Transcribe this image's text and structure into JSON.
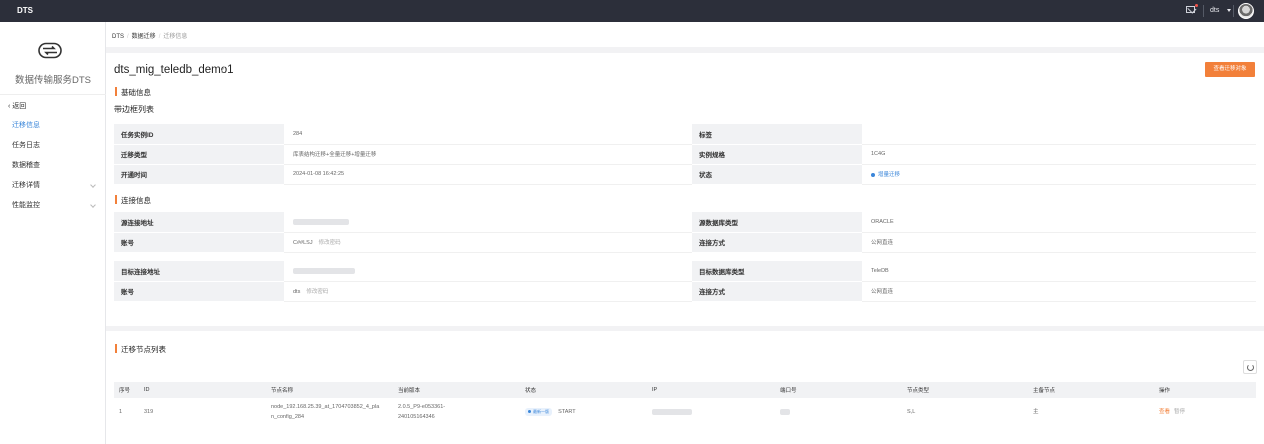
{
  "app": {
    "brand": "DTS",
    "user": "dts"
  },
  "sidebar": {
    "service_name": "数据传输服务DTS",
    "back_label": "返回",
    "items": [
      {
        "label": "迁移信息",
        "active": true,
        "expandable": false
      },
      {
        "label": "任务日志",
        "active": false,
        "expandable": false
      },
      {
        "label": "数据稽查",
        "active": false,
        "expandable": false
      },
      {
        "label": "迁移详情",
        "active": false,
        "expandable": true
      },
      {
        "label": "性能监控",
        "active": false,
        "expandable": true
      }
    ]
  },
  "breadcrumb": {
    "root": "DTS",
    "section": "数据迁移",
    "current": "迁移信息"
  },
  "page": {
    "title": "dts_mig_teledb_demo1",
    "view_objects_button": "查看迁移对象"
  },
  "basic": {
    "section_title": "基础信息",
    "table_title": "带边框列表",
    "rows": [
      {
        "k1": "任务实例ID",
        "v1": "284",
        "k2": "标签",
        "v2": ""
      },
      {
        "k1": "迁移类型",
        "v1": "库表结构迁移+全量迁移+增量迁移",
        "k2": "实例规格",
        "v2": "1C4G"
      },
      {
        "k1": "开通时间",
        "v1": "2024-01-08 16:42:25",
        "k2": "状态",
        "v2": "增量迁移"
      }
    ]
  },
  "connection": {
    "section_title": "连接信息",
    "source": {
      "addr_label": "源连接地址",
      "db_type_label": "源数据库类型",
      "db_type": "ORACLE",
      "account_label": "账号",
      "account": "C##LSJ",
      "change_pwd": "修改密码",
      "conn_label": "连接方式",
      "conn": "公网直连"
    },
    "target": {
      "addr_label": "目标连接地址",
      "db_type_label": "目标数据库类型",
      "db_type": "TeleDB",
      "account_label": "账号",
      "account": "dts",
      "change_pwd": "修改密码",
      "conn_label": "连接方式",
      "conn": "公网直连"
    }
  },
  "nodes": {
    "section_title": "迁移节点列表",
    "columns": [
      "序号",
      "ID",
      "节点名称",
      "当前版本",
      "状态",
      "IP",
      "端口号",
      "节点类型",
      "主备节点",
      "操作"
    ],
    "rows": [
      {
        "idx": "1",
        "id": "319",
        "name_line1": "node_192.168.25.39_at_1704703852_4_pla",
        "name_line2": "n_config_284",
        "version_line1": "2.0.5_P9-e053361-",
        "version_line2": "240105164346",
        "tag": "最新一版",
        "status": "START",
        "node_type": "S,L",
        "role": "主",
        "op_view": "查看",
        "op_pause": "暂停"
      }
    ]
  },
  "colors": {
    "accent": "#f2803a",
    "link": "#3a86d9",
    "topbar": "#2c2f3a"
  }
}
